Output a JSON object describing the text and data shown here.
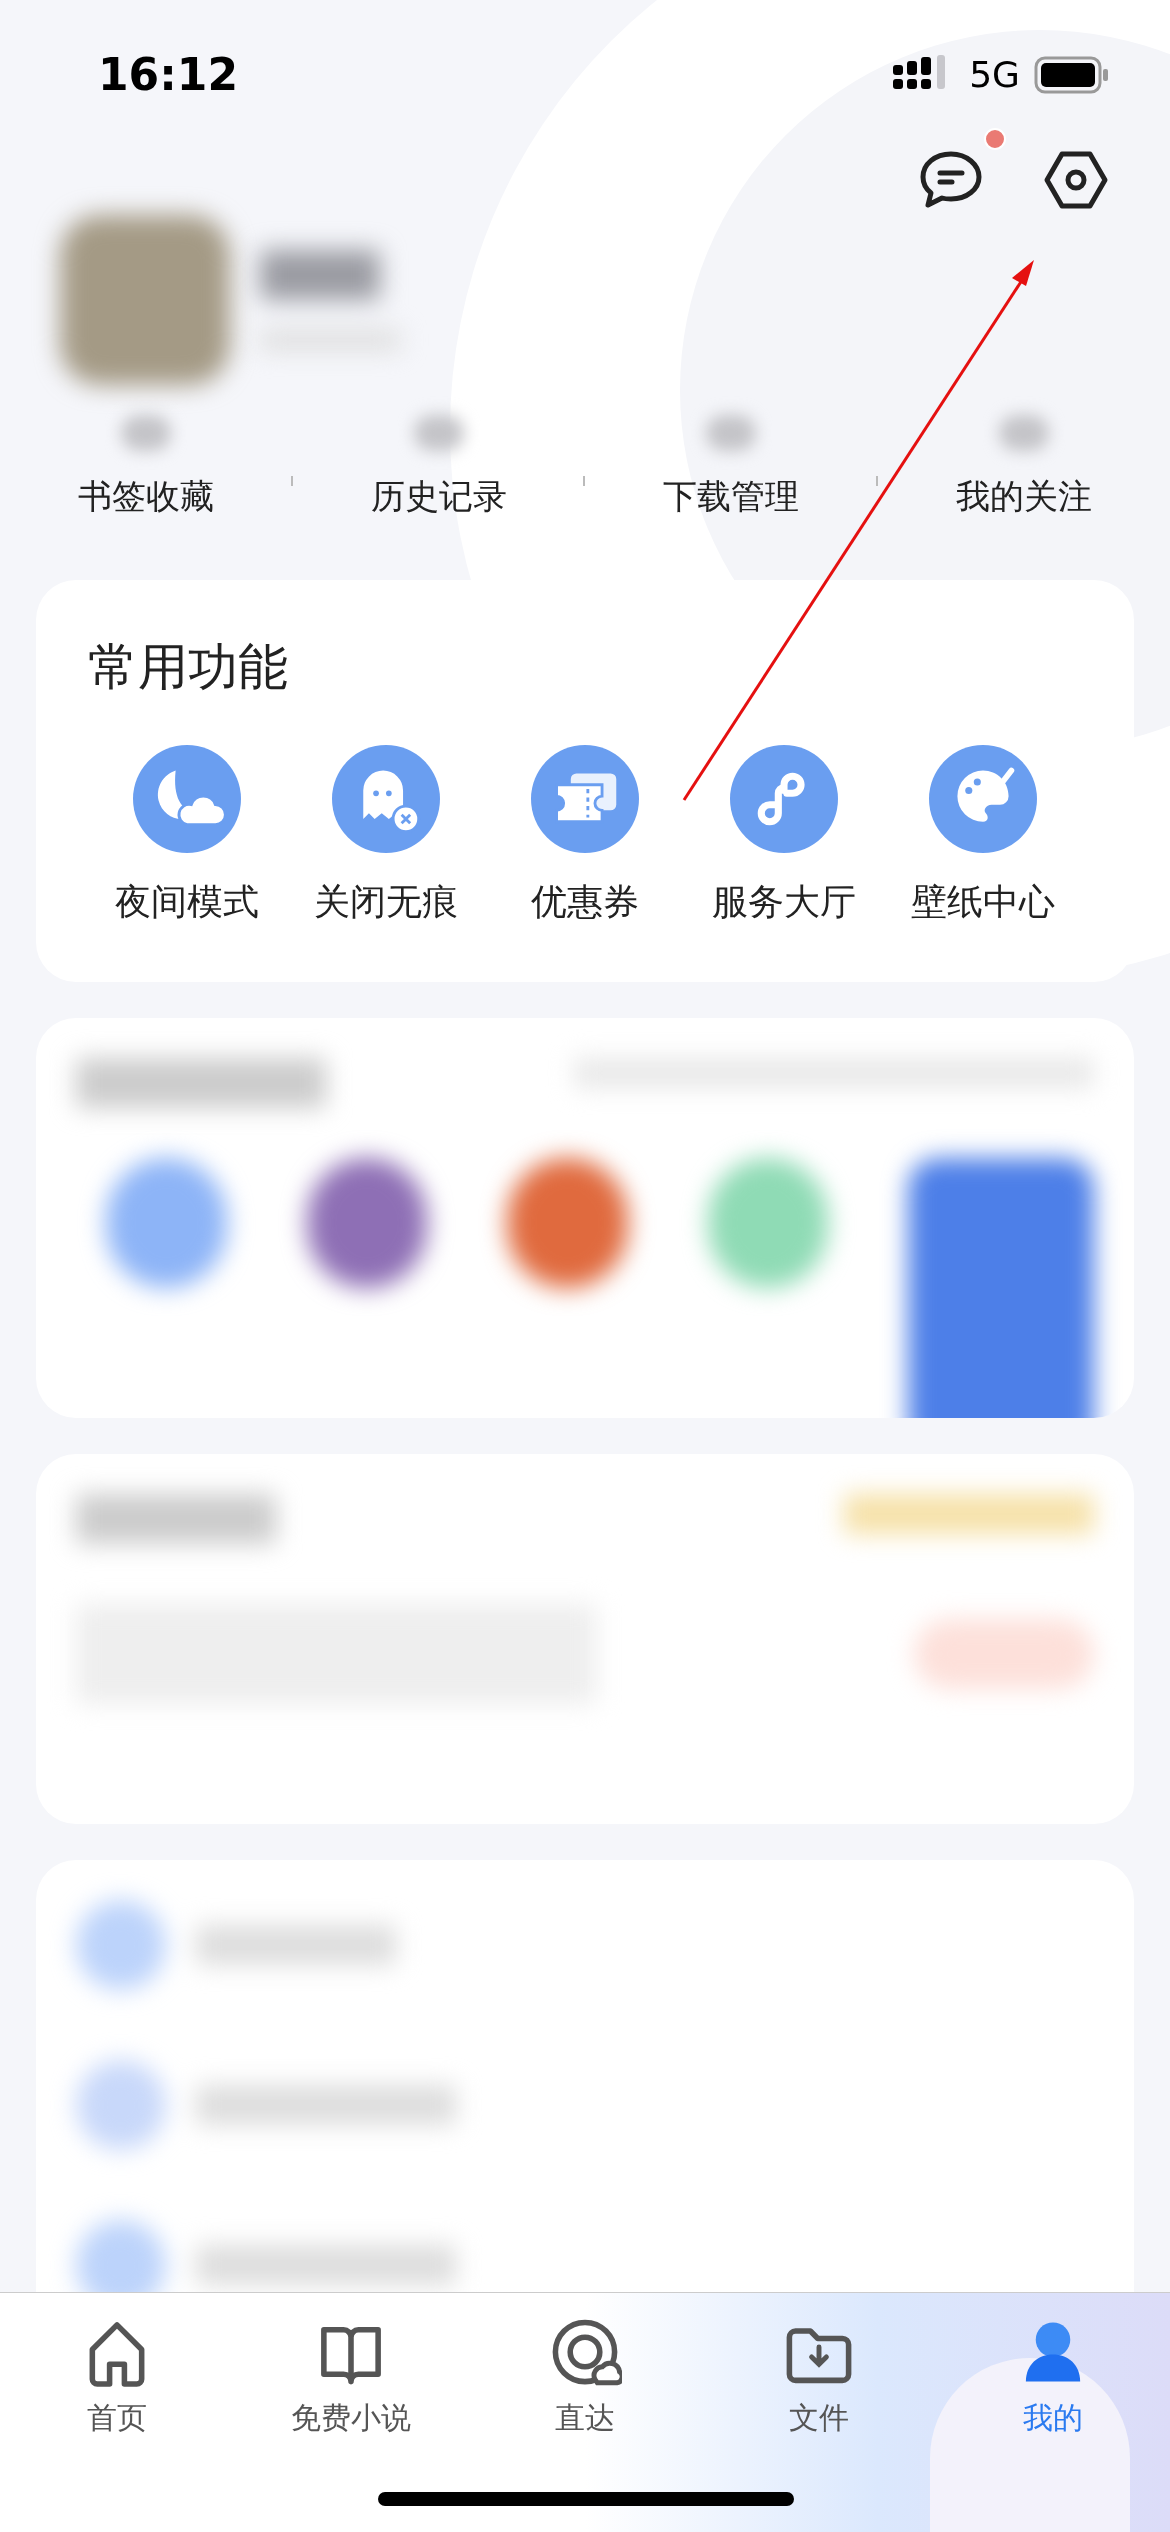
{
  "status_bar": {
    "time": "16:12",
    "network": "5G"
  },
  "header": {
    "message_badge": true
  },
  "shortcuts": [
    "书签收藏",
    "历史记录",
    "下载管理",
    "我的关注"
  ],
  "common_functions": {
    "title": "常用功能",
    "items": [
      "夜间模式",
      "关闭无痕",
      "优惠券",
      "服务大厅",
      "壁纸中心"
    ]
  },
  "tab_bar": [
    {
      "label": "首页",
      "selected": false
    },
    {
      "label": "免费小说",
      "selected": false
    },
    {
      "label": "直达",
      "selected": false
    },
    {
      "label": "文件",
      "selected": false
    },
    {
      "label": "我的",
      "selected": true
    }
  ]
}
